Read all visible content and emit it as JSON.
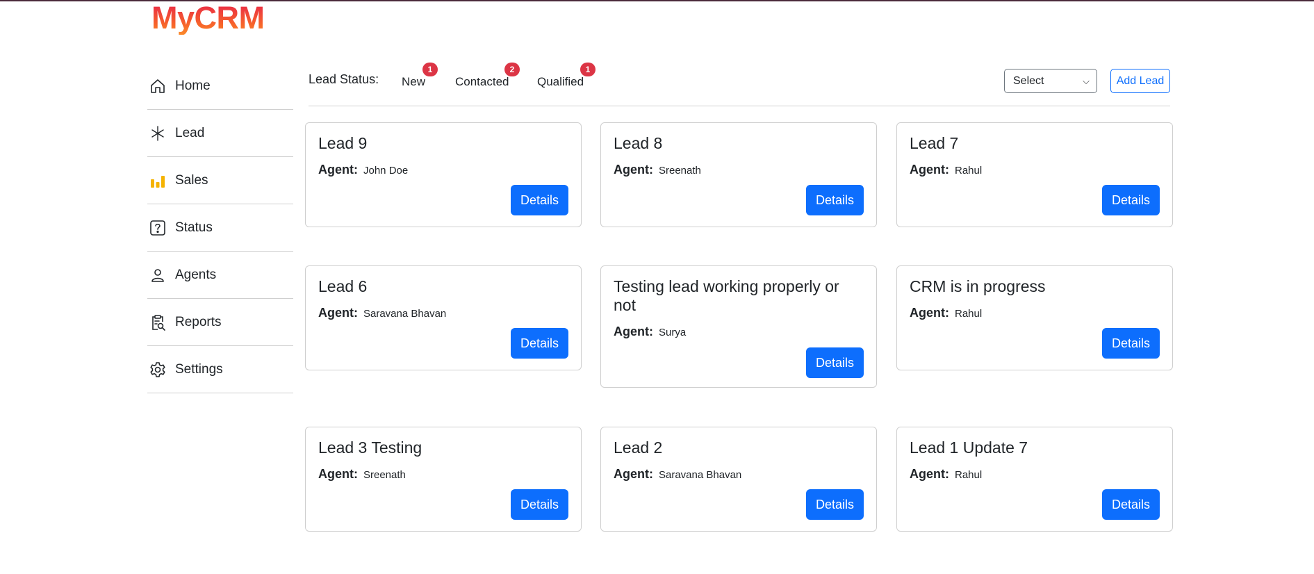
{
  "app": {
    "logo": "MyCRM"
  },
  "sidebar": {
    "items": [
      {
        "label": "Home",
        "icon": "home-icon"
      },
      {
        "label": "Lead",
        "icon": "asterisk-icon"
      },
      {
        "label": "Sales",
        "icon": "bar-chart-icon"
      },
      {
        "label": "Status",
        "icon": "question-icon"
      },
      {
        "label": "Agents",
        "icon": "person-icon"
      },
      {
        "label": "Reports",
        "icon": "clipboard-search-icon"
      },
      {
        "label": "Settings",
        "icon": "gear-icon"
      }
    ]
  },
  "status": {
    "title": "Lead Status:",
    "tabs": [
      {
        "label": "New",
        "count": "1"
      },
      {
        "label": "Contacted",
        "count": "2"
      },
      {
        "label": "Qualified",
        "count": "1"
      }
    ],
    "select_value": "Select",
    "add_label": "Add Lead"
  },
  "agent_label": "Agent:",
  "details_label": "Details",
  "leads": [
    {
      "title": "Lead 9",
      "agent": "John Doe"
    },
    {
      "title": "Lead 8",
      "agent": "Sreenath"
    },
    {
      "title": "Lead 7",
      "agent": "Rahul"
    },
    {
      "title": "Lead 6",
      "agent": "Saravana Bhavan"
    },
    {
      "title": "Testing lead working properly or not",
      "agent": "Surya"
    },
    {
      "title": "CRM is in progress",
      "agent": "Rahul"
    },
    {
      "title": "Lead 3 Testing",
      "agent": "Sreenath"
    },
    {
      "title": "Lead 2",
      "agent": "Saravana Bhavan"
    },
    {
      "title": "Lead 1 Update 7",
      "agent": "Rahul"
    }
  ],
  "colors": {
    "primary": "#0d6efd",
    "badge": "#dc3545",
    "sales_icon": "#f5b301"
  }
}
